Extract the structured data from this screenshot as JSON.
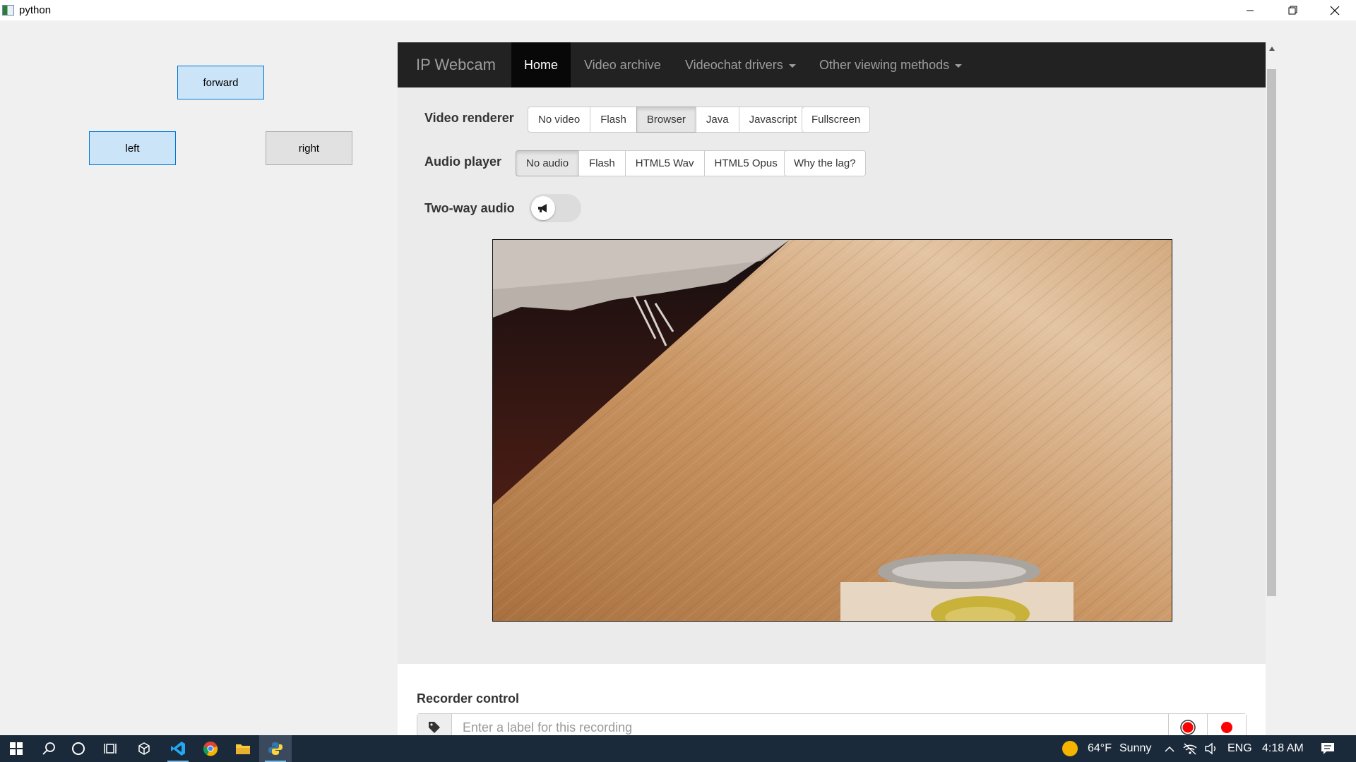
{
  "window": {
    "title": "python"
  },
  "controls": {
    "forward": "forward",
    "left": "left",
    "right": "right"
  },
  "webcam": {
    "brand": "IP Webcam",
    "nav": {
      "home": "Home",
      "video_archive": "Video archive",
      "videochat_drivers": "Videochat drivers",
      "other_viewing": "Other viewing methods"
    },
    "video_renderer": {
      "label": "Video renderer",
      "options": [
        "No video",
        "Flash",
        "Browser",
        "Java",
        "Javascript"
      ],
      "selected": "Browser",
      "fullscreen": "Fullscreen"
    },
    "audio_player": {
      "label": "Audio player",
      "options": [
        "No audio",
        "Flash",
        "HTML5 Wav",
        "HTML5 Opus"
      ],
      "selected": "No audio",
      "help": "Why the lag?"
    },
    "two_way_audio": {
      "label": "Two-way audio"
    },
    "recorder": {
      "title": "Recorder control",
      "placeholder": "Enter a label for this recording"
    }
  },
  "taskbar": {
    "weather_temp": "64°F",
    "weather_desc": "Sunny",
    "language": "ENG",
    "time": "4:18 AM"
  },
  "colors": {
    "navbar_bg": "#222222",
    "tk_active_bg": "#cce4f7",
    "tk_active_border": "#0078d7",
    "record_red": "#ff0000"
  }
}
